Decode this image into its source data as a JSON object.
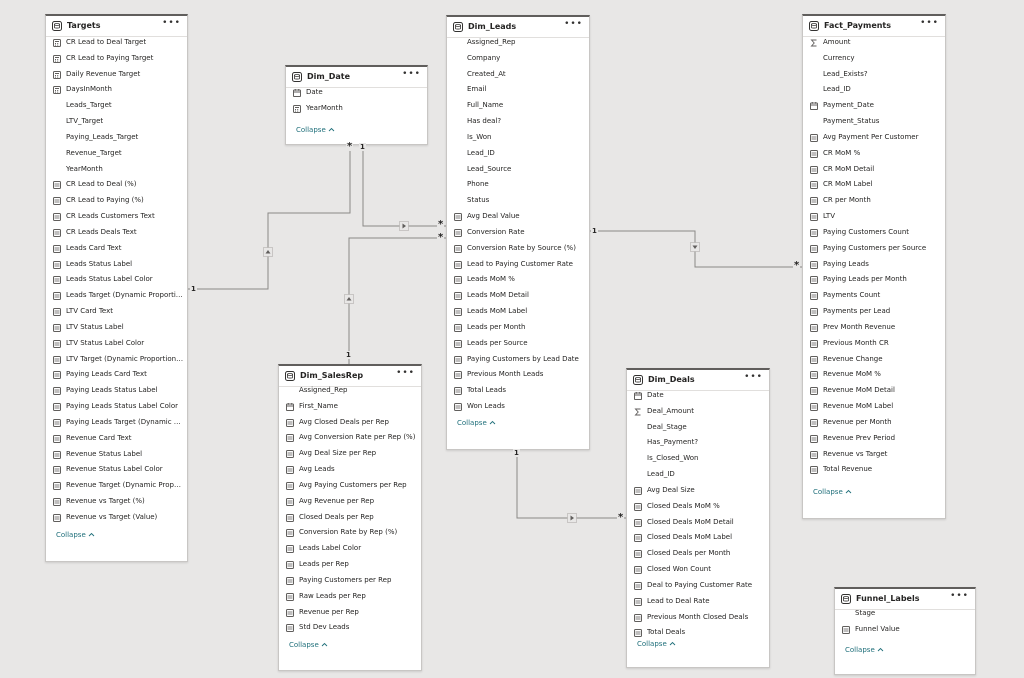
{
  "tables": [
    {
      "key": "targets",
      "title": "Targets",
      "collapse": "Collapse",
      "fields": [
        {
          "label": "CR Lead to Deal Target",
          "icon": "calculator"
        },
        {
          "label": "CR Lead to Paying Target",
          "icon": "calculator"
        },
        {
          "label": "Daily Revenue Target",
          "icon": "calculator"
        },
        {
          "label": "DaysInMonth",
          "icon": "calculator"
        },
        {
          "label": "Leads_Target",
          "icon": "none"
        },
        {
          "label": "LTV_Target",
          "icon": "none"
        },
        {
          "label": "Paying_Leads_Target",
          "icon": "none"
        },
        {
          "label": "Revenue_Target",
          "icon": "none"
        },
        {
          "label": "YearMonth",
          "icon": "none"
        },
        {
          "label": "CR Lead to Deal (%)",
          "icon": "measure"
        },
        {
          "label": "CR Lead to Paying (%)",
          "icon": "measure"
        },
        {
          "label": "CR Leads Customers Text",
          "icon": "measure"
        },
        {
          "label": "CR Leads Deals Text",
          "icon": "measure"
        },
        {
          "label": "Leads Card Text",
          "icon": "measure"
        },
        {
          "label": "Leads Status Label",
          "icon": "measure"
        },
        {
          "label": "Leads Status Label Color",
          "icon": "measure"
        },
        {
          "label": "Leads Target (Dynamic Proportional)",
          "icon": "measure"
        },
        {
          "label": "LTV Card Text",
          "icon": "measure"
        },
        {
          "label": "LTV Status Label",
          "icon": "measure"
        },
        {
          "label": "LTV Status Label Color",
          "icon": "measure"
        },
        {
          "label": "LTV Target (Dynamic Proportional)",
          "icon": "measure"
        },
        {
          "label": "Paying Leads Card Text",
          "icon": "measure"
        },
        {
          "label": "Paying Leads Status Label",
          "icon": "measure"
        },
        {
          "label": "Paying Leads Status Label Color",
          "icon": "measure"
        },
        {
          "label": "Paying Leads Target (Dynamic Pro...",
          "icon": "measure"
        },
        {
          "label": "Revenue Card Text",
          "icon": "measure"
        },
        {
          "label": "Revenue Status Label",
          "icon": "measure"
        },
        {
          "label": "Revenue Status Label Color",
          "icon": "measure"
        },
        {
          "label": "Revenue Target (Dynamic Proporti...",
          "icon": "measure"
        },
        {
          "label": "Revenue vs Target (%)",
          "icon": "measure"
        },
        {
          "label": "Revenue vs Target (Value)",
          "icon": "measure"
        }
      ]
    },
    {
      "key": "dim_date",
      "title": "Dim_Date",
      "collapse": "Collapse",
      "fields": [
        {
          "label": "Date",
          "icon": "date"
        },
        {
          "label": "YearMonth",
          "icon": "calculator"
        }
      ]
    },
    {
      "key": "dim_leads",
      "title": "Dim_Leads",
      "collapse": "Collapse",
      "fields": [
        {
          "label": "Assigned_Rep",
          "icon": "none"
        },
        {
          "label": "Company",
          "icon": "none"
        },
        {
          "label": "Created_At",
          "icon": "none"
        },
        {
          "label": "Email",
          "icon": "none"
        },
        {
          "label": "Full_Name",
          "icon": "none"
        },
        {
          "label": "Has deal?",
          "icon": "none"
        },
        {
          "label": "Is_Won",
          "icon": "none"
        },
        {
          "label": "Lead_ID",
          "icon": "none"
        },
        {
          "label": "Lead_Source",
          "icon": "none"
        },
        {
          "label": "Phone",
          "icon": "none"
        },
        {
          "label": "Status",
          "icon": "none"
        },
        {
          "label": "Avg Deal Value",
          "icon": "measure"
        },
        {
          "label": "Conversion Rate",
          "icon": "measure"
        },
        {
          "label": "Conversion Rate by Source (%)",
          "icon": "measure"
        },
        {
          "label": "Lead to Paying Customer Rate",
          "icon": "measure"
        },
        {
          "label": "Leads MoM %",
          "icon": "measure"
        },
        {
          "label": "Leads MoM Detail",
          "icon": "measure"
        },
        {
          "label": "Leads MoM Label",
          "icon": "measure"
        },
        {
          "label": "Leads per Month",
          "icon": "measure"
        },
        {
          "label": "Leads per Source",
          "icon": "measure"
        },
        {
          "label": "Paying Customers by Lead Date",
          "icon": "measure"
        },
        {
          "label": "Previous Month Leads",
          "icon": "measure"
        },
        {
          "label": "Total Leads",
          "icon": "measure"
        },
        {
          "label": "Won Leads",
          "icon": "measure"
        }
      ]
    },
    {
      "key": "fact_payments",
      "title": "Fact_Payments",
      "collapse": "Collapse",
      "fields": [
        {
          "label": "Amount",
          "icon": "sigma"
        },
        {
          "label": "Currency",
          "icon": "none"
        },
        {
          "label": "Lead_Exists?",
          "icon": "none"
        },
        {
          "label": "Lead_ID",
          "icon": "none"
        },
        {
          "label": "Payment_Date",
          "icon": "date"
        },
        {
          "label": "Payment_Status",
          "icon": "none"
        },
        {
          "label": "Avg Payment Per Customer",
          "icon": "measure"
        },
        {
          "label": "CR MoM %",
          "icon": "measure"
        },
        {
          "label": "CR MoM Detail",
          "icon": "measure"
        },
        {
          "label": "CR MoM Label",
          "icon": "measure"
        },
        {
          "label": "CR per Month",
          "icon": "measure"
        },
        {
          "label": "LTV",
          "icon": "measure"
        },
        {
          "label": "Paying Customers Count",
          "icon": "measure"
        },
        {
          "label": "Paying Customers per Source",
          "icon": "measure"
        },
        {
          "label": "Paying Leads",
          "icon": "measure"
        },
        {
          "label": "Paying Leads per Month",
          "icon": "measure"
        },
        {
          "label": "Payments Count",
          "icon": "measure"
        },
        {
          "label": "Payments per Lead",
          "icon": "measure"
        },
        {
          "label": "Prev Month Revenue",
          "icon": "measure"
        },
        {
          "label": "Previous Month CR",
          "icon": "measure"
        },
        {
          "label": "Revenue Change",
          "icon": "measure"
        },
        {
          "label": "Revenue MoM %",
          "icon": "measure"
        },
        {
          "label": "Revenue MoM Detail",
          "icon": "measure"
        },
        {
          "label": "Revenue MoM Label",
          "icon": "measure"
        },
        {
          "label": "Revenue per Month",
          "icon": "measure"
        },
        {
          "label": "Revenue Prev Period",
          "icon": "measure"
        },
        {
          "label": "Revenue vs Target",
          "icon": "measure"
        },
        {
          "label": "Total Revenue",
          "icon": "measure"
        }
      ]
    },
    {
      "key": "dim_salesrep",
      "title": "Dim_SalesRep",
      "collapse": "Collapse",
      "fields": [
        {
          "label": "Assigned_Rep",
          "icon": "none"
        },
        {
          "label": "First_Name",
          "icon": "date"
        },
        {
          "label": "Avg Closed Deals per Rep",
          "icon": "measure"
        },
        {
          "label": "Avg Conversion Rate per Rep (%)",
          "icon": "measure"
        },
        {
          "label": "Avg Deal Size per Rep",
          "icon": "measure"
        },
        {
          "label": "Avg Leads",
          "icon": "measure"
        },
        {
          "label": "Avg Paying Customers per Rep",
          "icon": "measure"
        },
        {
          "label": "Avg Revenue per Rep",
          "icon": "measure"
        },
        {
          "label": "Closed Deals per Rep",
          "icon": "measure"
        },
        {
          "label": "Conversion Rate by Rep (%)",
          "icon": "measure"
        },
        {
          "label": "Leads Label Color",
          "icon": "measure"
        },
        {
          "label": "Leads per Rep",
          "icon": "measure"
        },
        {
          "label": "Paying Customers per Rep",
          "icon": "measure"
        },
        {
          "label": "Raw Leads per Rep",
          "icon": "measure"
        },
        {
          "label": "Revenue per Rep",
          "icon": "measure"
        },
        {
          "label": "Std Dev Leads",
          "icon": "measure"
        }
      ]
    },
    {
      "key": "dim_deals",
      "title": "Dim_Deals",
      "collapse": "Collapse",
      "fields": [
        {
          "label": "Date",
          "icon": "date"
        },
        {
          "label": "Deal_Amount",
          "icon": "sigma"
        },
        {
          "label": "Deal_Stage",
          "icon": "none"
        },
        {
          "label": "Has_Payment?",
          "icon": "none"
        },
        {
          "label": "Is_Closed_Won",
          "icon": "none"
        },
        {
          "label": "Lead_ID",
          "icon": "none"
        },
        {
          "label": "Avg Deal Size",
          "icon": "measure"
        },
        {
          "label": "Closed Deals MoM %",
          "icon": "measure"
        },
        {
          "label": "Closed Deals MoM Detail",
          "icon": "measure"
        },
        {
          "label": "Closed Deals MoM Label",
          "icon": "measure"
        },
        {
          "label": "Closed Deals per Month",
          "icon": "measure"
        },
        {
          "label": "Closed Won Count",
          "icon": "measure"
        },
        {
          "label": "Deal to Paying Customer Rate",
          "icon": "measure"
        },
        {
          "label": "Lead to Deal Rate",
          "icon": "measure"
        },
        {
          "label": "Previous Month Closed Deals",
          "icon": "measure"
        },
        {
          "label": "Total Deals",
          "icon": "measure"
        }
      ]
    },
    {
      "key": "funnel_labels",
      "title": "Funnel_Labels",
      "collapse": "Collapse",
      "fields": [
        {
          "label": "Stage",
          "icon": "none"
        },
        {
          "label": "Funnel Value",
          "icon": "measure"
        }
      ]
    }
  ],
  "relationships": [
    {
      "key": "targets_date",
      "from": "Targets",
      "to": "Dim_Date",
      "from_card": "1",
      "to_card": "*"
    },
    {
      "key": "date_leads",
      "from": "Dim_Date",
      "to": "Dim_Leads",
      "from_card": "1",
      "to_card": "*"
    },
    {
      "key": "salesrep_leads",
      "from": "Dim_SalesRep",
      "to": "Dim_Leads",
      "from_card": "1",
      "to_card": "*"
    },
    {
      "key": "leads_payments",
      "from": "Dim_Leads",
      "to": "Fact_Payments",
      "from_card": "1",
      "to_card": "*"
    },
    {
      "key": "leads_deals",
      "from": "Dim_Leads",
      "to": "Dim_Deals",
      "from_card": "1",
      "to_card": "*"
    }
  ],
  "menu_glyph": "•••"
}
